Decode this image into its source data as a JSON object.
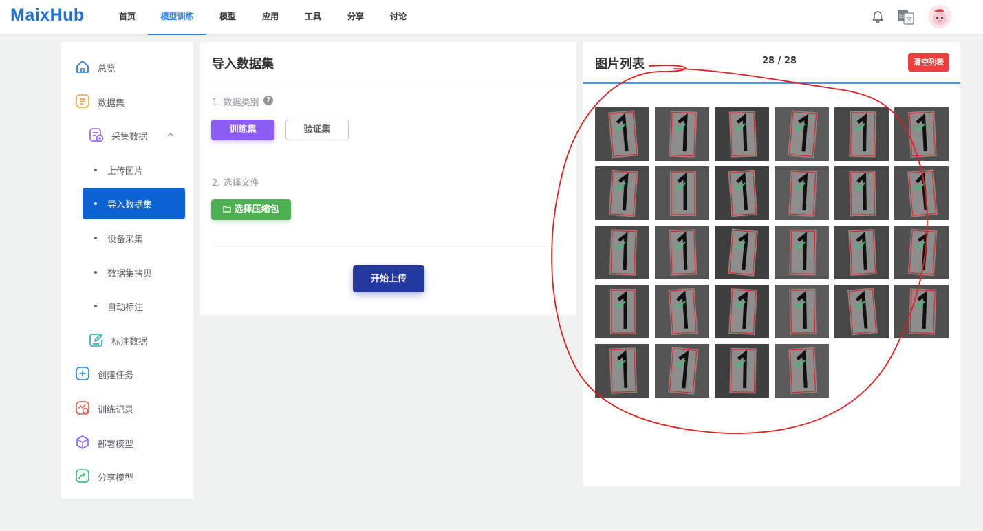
{
  "app": {
    "logo": "MaixHub"
  },
  "nav": {
    "items": [
      {
        "label": "首页"
      },
      {
        "label": "模型训练",
        "active": true
      },
      {
        "label": "模型"
      },
      {
        "label": "应用"
      },
      {
        "label": "工具"
      },
      {
        "label": "分享"
      },
      {
        "label": "讨论"
      }
    ],
    "icons": [
      "bell-icon",
      "language-icon",
      "avatar"
    ]
  },
  "sidebar": {
    "overview": "总览",
    "dataset": "数据集",
    "collect": "采集数据",
    "upload_images": "上传图片",
    "import_dataset": "导入数据集",
    "device_collect": "设备采集",
    "dataset_copy": "数据集拷贝",
    "auto_label": "自动标注",
    "label_data": "标注数据",
    "create_task": "创建任务",
    "train_records": "训练记录",
    "deploy_model": "部署模型",
    "share_model": "分享模型"
  },
  "form": {
    "title": "导入数据集",
    "step1": "1. 数据类别",
    "train_set": "训练集",
    "val_set": "验证集",
    "step2": "2. 选择文件",
    "choose_zip": "选择压缩包",
    "start_upload": "开始上传"
  },
  "list": {
    "title": "图片列表",
    "count": "28 / 28",
    "clear": "清空列表",
    "thumb_count": 28
  },
  "colors": {
    "accent": "#2f80ed",
    "sidebar_active": "#0d63d4",
    "train_button": "#8b5cf6",
    "zip_button": "#4caf50",
    "upload_button": "#23399f",
    "clear_button": "#f03e3e",
    "annotation": "#e02020"
  }
}
